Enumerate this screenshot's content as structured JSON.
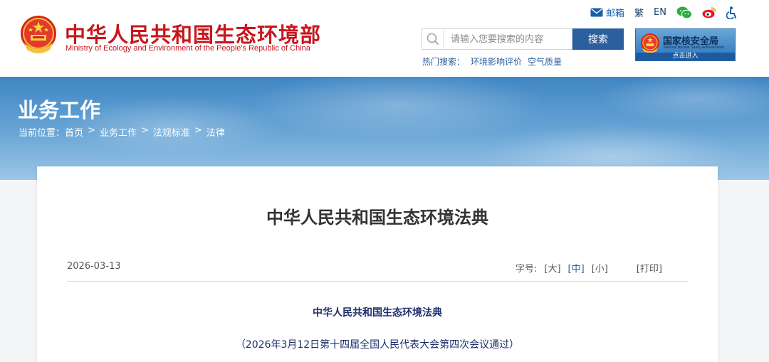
{
  "header": {
    "site_title": "中华人民共和国生态环境部",
    "site_subtitle": "Ministry of Ecology and Environment of the People's Republic of China",
    "top_links": {
      "mail": "邮箱",
      "traditional": "繁",
      "english": "EN"
    },
    "search": {
      "placeholder": "请输入您要搜索的内容",
      "button_label": "搜索"
    },
    "hot_search": {
      "label": "热门搜索：",
      "items": [
        "环境影响评价",
        "空气质量"
      ]
    },
    "nsa_banner": {
      "title": "国家核安全局",
      "subtitle": "National Nuclear Safety Administration",
      "enter_label": "点击进入"
    },
    "colors": {
      "brand_red": "#c8161d",
      "link_blue": "#2b5f9e"
    }
  },
  "banner": {
    "section_title": "业务工作",
    "breadcrumb": {
      "prefix": "当前位置：",
      "items": [
        "首页",
        "业务工作",
        "法规标准",
        "法律"
      ],
      "separator": ">"
    }
  },
  "article": {
    "title": "中华人民共和国生态环境法典",
    "date": "2026-03-13",
    "font_controls": {
      "label": "字号:",
      "large": "[大]",
      "medium": "[中]",
      "small": "[小]",
      "print": "[打印]"
    },
    "law_heading": "中华人民共和国生态环境法典",
    "law_note": "（2026年3月12日第十四届全国人民代表大会第四次会议通过）"
  },
  "icons": [
    "mail-icon",
    "wechat-icon",
    "weibo-icon",
    "accessibility-icon",
    "search-icon",
    "national-emblem-icon"
  ]
}
